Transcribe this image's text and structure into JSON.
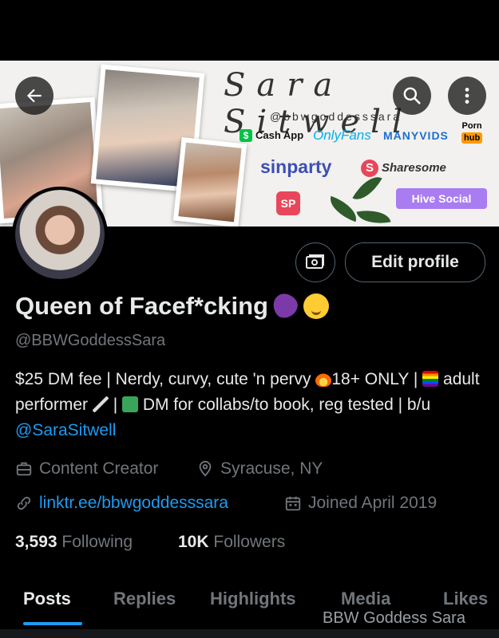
{
  "banner": {
    "script_title": "Sara Sitwell",
    "handle": "@bbwgoddesssara",
    "brands": {
      "cashapp": "Cash App",
      "cashapp_glyph": "$",
      "onlyfans": "OnlyFans",
      "manyvids": "MANYVIDS",
      "pornhub_top": "Porn",
      "pornhub_bottom": "hub",
      "sinparty": "sinparty",
      "sharesome": "Sharesome",
      "sharesome_glyph": "S",
      "sp_glyph": "SP",
      "hive": "Hive Social"
    }
  },
  "header_buttons": {
    "back_icon": "arrow-left-icon",
    "search_icon": "search-icon",
    "more_icon": "more-vertical-icon"
  },
  "profile": {
    "display_name": "Queen of Facef*cking",
    "handle": "@BBWGoddessSara",
    "edit_profile_label": "Edit profile",
    "bio": {
      "part1": "$25 DM fee | Nerdy, curvy, cute 'n pervy ",
      "part2": "18+ ONLY | ",
      "part3": " adult performer ",
      "part4": " | ",
      "part5": " DM for collabs/to book, reg tested | b/u ",
      "mention": "@SaraSitwell"
    },
    "category": "Content Creator",
    "location": "Syracuse, NY",
    "link": "linktr.ee/bbwgoddesssara",
    "joined": "Joined April 2019",
    "following_count": "3,593",
    "following_label": "Following",
    "followers_count": "10K",
    "followers_label": "Followers"
  },
  "tabs": [
    {
      "label": "Posts",
      "active": true
    },
    {
      "label": "Replies",
      "active": false
    },
    {
      "label": "Highlights",
      "active": false
    },
    {
      "label": "Media",
      "active": false
    },
    {
      "label": "Likes",
      "active": false
    }
  ],
  "watermark": "BBW Goddess Sara",
  "colors": {
    "background": "#000000",
    "accent_blue": "#1d9bf0",
    "secondary_text": "#71767b",
    "primary_text": "#e7e9ea"
  }
}
